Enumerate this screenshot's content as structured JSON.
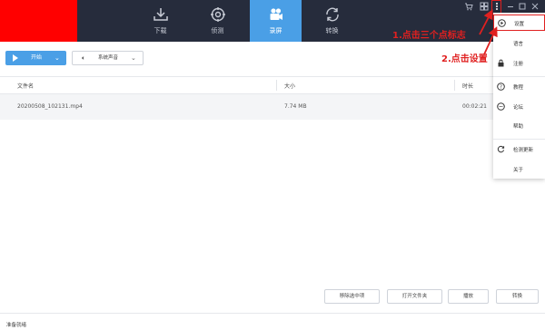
{
  "tabs": [
    {
      "label": "下载",
      "icon": "download-icon"
    },
    {
      "label": "侦测",
      "icon": "detect-icon"
    },
    {
      "label": "录屏",
      "icon": "record-icon",
      "active": true
    },
    {
      "label": "转换",
      "icon": "convert-icon"
    }
  ],
  "toolbar": {
    "start_label": "开始",
    "audio_label": "系统声音"
  },
  "table": {
    "headers": [
      "文件名",
      "大小",
      "时长"
    ],
    "rows": [
      {
        "name": "20200508_102131.mp4",
        "size": "7.74 MB",
        "duration": "00:02:21"
      }
    ]
  },
  "bottom_buttons": [
    "移除选中项",
    "打开文件夹",
    "播放",
    "转换"
  ],
  "status": "准备就绪",
  "menu": {
    "items": [
      {
        "label": "设置",
        "icon": "settings-icon"
      },
      {
        "label": "语言",
        "icon": "language-icon"
      },
      {
        "label": "注册",
        "icon": "lock-icon"
      },
      {
        "label": "教程",
        "icon": "help-icon"
      },
      {
        "label": "论坛",
        "icon": "forum-icon"
      },
      {
        "label": "帮助",
        "icon": "help-doc-icon"
      },
      {
        "label": "检测更新",
        "icon": "refresh-icon"
      },
      {
        "label": "关于",
        "icon": "info-icon"
      }
    ]
  },
  "annotations": {
    "step1": "1.点击三个点标志",
    "step2": "2.点击设置"
  },
  "colors": {
    "topbar": "#262c3c",
    "accent": "#4a9fe6",
    "annotation": "#e02020",
    "logo": "#ff0000"
  }
}
